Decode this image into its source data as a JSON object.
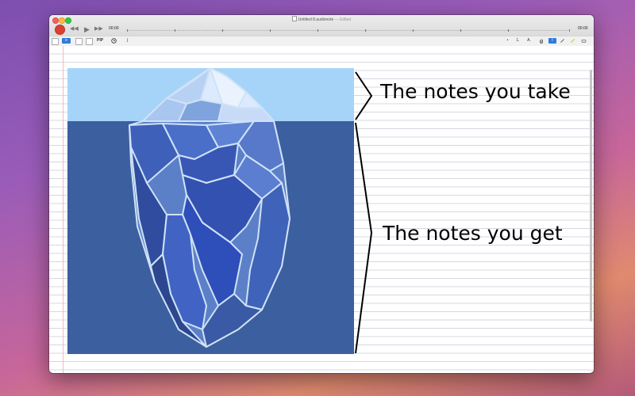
{
  "window": {
    "title": "Untitled 8.audionote",
    "title_status": "— Edited"
  },
  "transport": {
    "rewind_glyph": "◀◀",
    "play_glyph": "▶",
    "forward_glyph": "▶▶",
    "current_time": "00:00",
    "total_time": "00:00"
  },
  "toolbar": {
    "pip_label": "PIP",
    "formula_label": "∫",
    "bullet_label": "•",
    "numbered_label": "1.",
    "text_style_label": "A.",
    "text_cursor_label": "I"
  },
  "canvas": {
    "top_caption": "The notes you take",
    "bottom_caption": "The notes you get",
    "sky_color": "#a6d4f9",
    "water_color": "#3c5f9f"
  }
}
